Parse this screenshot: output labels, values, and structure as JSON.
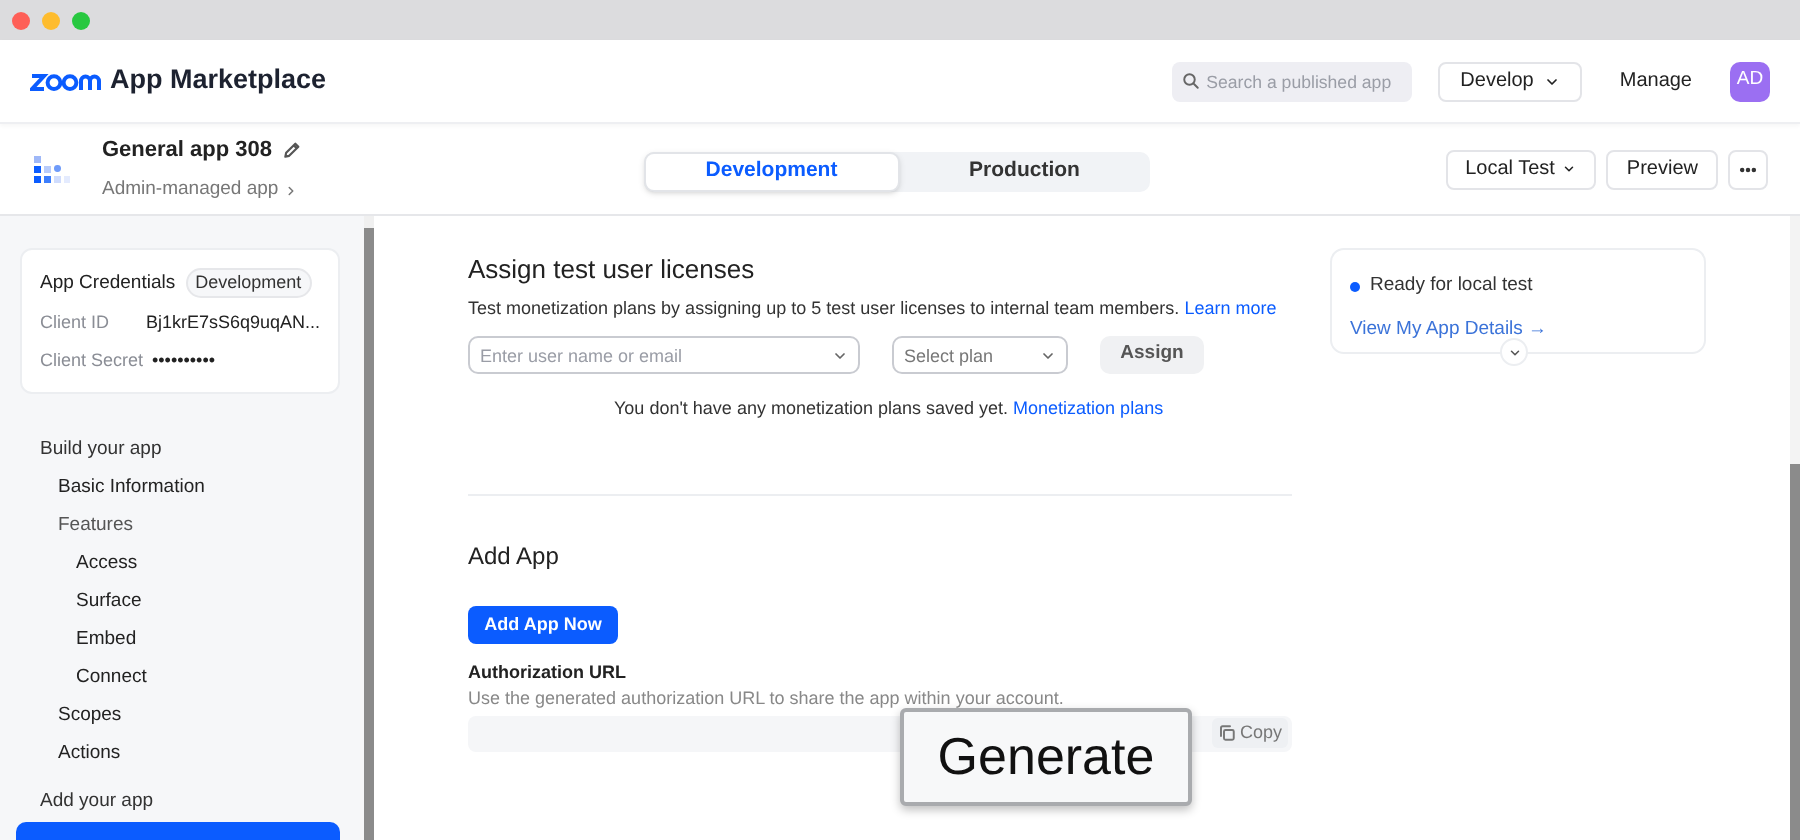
{
  "header": {
    "brand": "App Marketplace",
    "search": {
      "placeholder": "Search a published app"
    },
    "develop": "Develop",
    "manage": "Manage",
    "avatar": "AD"
  },
  "app_bar": {
    "name": "General app 308",
    "subtitle": "Admin-managed app",
    "tabs": [
      {
        "label": "Development",
        "selected": true
      },
      {
        "label": "Production",
        "selected": false
      }
    ],
    "local_test": "Local Test",
    "preview": "Preview"
  },
  "credentials": {
    "title": "App Credentials",
    "badge": "Development",
    "rows": [
      {
        "label": "Client ID",
        "value": "Bj1krE7sS6q9uqAN..."
      },
      {
        "label": "Client Secret",
        "value": "••••••••••"
      }
    ]
  },
  "sidebar": {
    "sections": [
      {
        "title": "Build your app",
        "items": [
          {
            "label": "Basic Information"
          },
          {
            "label": "Features",
            "children": [
              {
                "label": "Access"
              },
              {
                "label": "Surface"
              },
              {
                "label": "Embed"
              },
              {
                "label": "Connect"
              }
            ]
          },
          {
            "label": "Scopes"
          },
          {
            "label": "Actions"
          }
        ]
      },
      {
        "title": "Add your app",
        "items": [
          {
            "selected": true
          }
        ]
      }
    ]
  },
  "licenses": {
    "title": "Assign test user licenses",
    "description": "Test monetization plans by assigning up to 5 test user licenses to internal team members.",
    "learn_more": "Learn more",
    "user_field": {
      "placeholder": "Enter user name or email"
    },
    "plan_field": {
      "placeholder": "Select plan"
    },
    "assign": "Assign",
    "empty_note": "You don't have any monetization plans saved yet.",
    "empty_link": "Monetization plans"
  },
  "add_app": {
    "title": "Add App",
    "button": "Add App Now",
    "auth_label": "Authorization URL",
    "auth_hint": "Use the generated authorization URL to share the app within your account.",
    "copy": "Copy",
    "tooltip": "Generate"
  },
  "status_card": {
    "status": "Ready for local test",
    "link": "View My App Details →"
  }
}
